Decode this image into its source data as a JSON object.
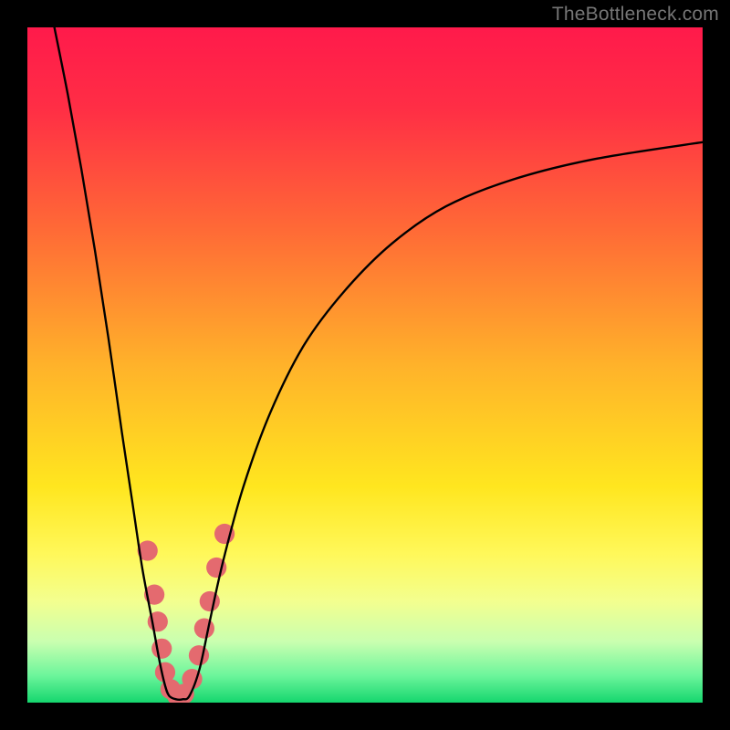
{
  "watermark": "TheBottleneck.com",
  "chart_data": {
    "type": "line",
    "title": "",
    "xlabel": "",
    "ylabel": "",
    "xlim": [
      0,
      100
    ],
    "ylim": [
      0,
      100
    ],
    "background_gradient_stops": [
      {
        "pct": 0,
        "color": "#ff1a4b"
      },
      {
        "pct": 12,
        "color": "#ff2e45"
      },
      {
        "pct": 30,
        "color": "#ff6a36"
      },
      {
        "pct": 50,
        "color": "#ffb22a"
      },
      {
        "pct": 68,
        "color": "#ffe61f"
      },
      {
        "pct": 78,
        "color": "#fff85a"
      },
      {
        "pct": 85,
        "color": "#f3ff8f"
      },
      {
        "pct": 91,
        "color": "#c9ffb0"
      },
      {
        "pct": 96,
        "color": "#6cf59b"
      },
      {
        "pct": 100,
        "color": "#15d66e"
      }
    ],
    "series": [
      {
        "name": "left_branch",
        "x": [
          4.0,
          6.0,
          8.0,
          10.0,
          12.0,
          14.0,
          15.5,
          17.0,
          18.5,
          19.6,
          20.4,
          21.0
        ],
        "y": [
          100.0,
          90.0,
          79.0,
          67.0,
          54.0,
          40.0,
          30.0,
          20.0,
          12.0,
          6.0,
          2.5,
          1.0
        ]
      },
      {
        "name": "valley_floor",
        "x": [
          21.0,
          22.0,
          23.0,
          24.0
        ],
        "y": [
          1.0,
          0.5,
          0.5,
          1.0
        ]
      },
      {
        "name": "right_branch",
        "x": [
          24.0,
          25.5,
          27.0,
          29.0,
          32.0,
          36.0,
          41.0,
          47.0,
          54.0,
          62.0,
          72.0,
          84.0,
          100.0
        ],
        "y": [
          1.0,
          5.0,
          12.0,
          21.0,
          32.0,
          43.0,
          53.0,
          61.0,
          68.0,
          73.5,
          77.5,
          80.5,
          83.0
        ]
      }
    ],
    "markers": {
      "name": "salmon_dots",
      "color": "#e46a6f",
      "radius_pct": 1.5,
      "points": [
        {
          "x": 17.8,
          "y": 22.5
        },
        {
          "x": 18.8,
          "y": 16.0
        },
        {
          "x": 19.3,
          "y": 12.0
        },
        {
          "x": 19.9,
          "y": 8.0
        },
        {
          "x": 20.4,
          "y": 4.5
        },
        {
          "x": 21.2,
          "y": 2.0
        },
        {
          "x": 22.2,
          "y": 1.0
        },
        {
          "x": 23.2,
          "y": 1.3
        },
        {
          "x": 24.4,
          "y": 3.5
        },
        {
          "x": 25.4,
          "y": 7.0
        },
        {
          "x": 26.2,
          "y": 11.0
        },
        {
          "x": 27.0,
          "y": 15.0
        },
        {
          "x": 28.0,
          "y": 20.0
        },
        {
          "x": 29.2,
          "y": 25.0
        }
      ]
    }
  }
}
